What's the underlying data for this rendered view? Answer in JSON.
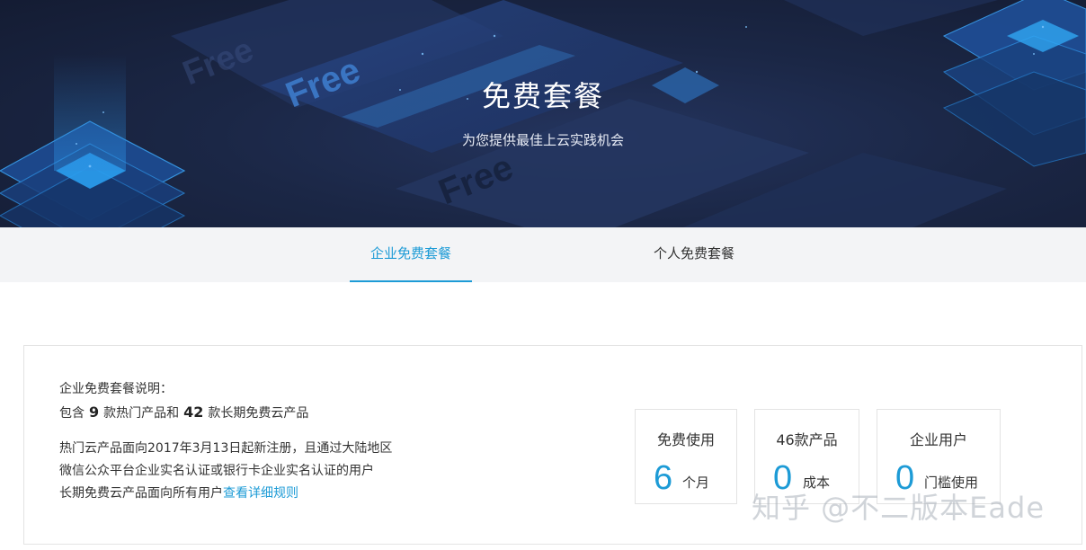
{
  "hero": {
    "title": "免费套餐",
    "subtitle": "为您提供最佳上云实践机会",
    "decor_text": "Free"
  },
  "tabs": [
    {
      "label": "企业免费套餐",
      "active": true
    },
    {
      "label": "个人免费套餐",
      "active": false
    }
  ],
  "description": {
    "heading": "企业免费套餐说明：",
    "summary_prefix": "包含",
    "hot_count": "9",
    "summary_mid": "款热门产品和",
    "long_count": "42",
    "summary_suffix": "款长期免费云产品",
    "note_line1": "热门云产品面向2017年3月13日起新注册，且通过大陆地区",
    "note_line2": "微信公众平台企业实名认证或银行卡企业实名认证的用户",
    "note_line3": "长期免费云产品面向所有用户",
    "rules_link": "查看详细规则"
  },
  "stats": [
    {
      "label": "免费使用",
      "value": "6",
      "unit": "个月"
    },
    {
      "label": "46款产品",
      "value": "0",
      "unit": "成本"
    },
    {
      "label": "企业用户",
      "value": "0",
      "unit": "门槛使用"
    }
  ],
  "watermark": "知乎 @不二版本Eade",
  "colors": {
    "accent": "#1d9bd6",
    "hero_bg": "#1b2746",
    "tab_bar_bg": "#f3f4f6"
  }
}
